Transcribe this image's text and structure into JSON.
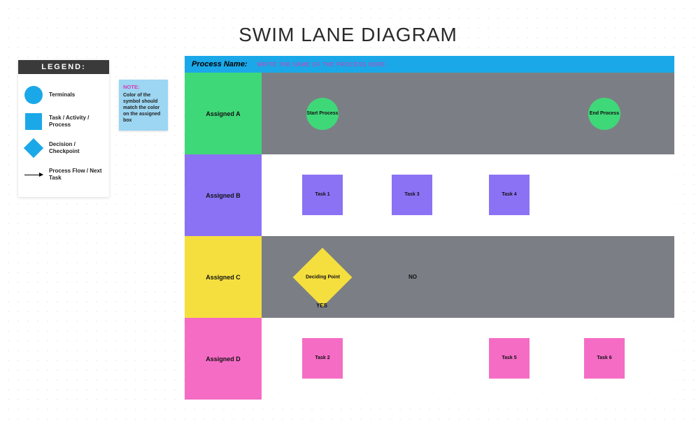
{
  "title": "SWIM LANE DIAGRAM",
  "legend": {
    "header": "LEGEND:",
    "items": [
      {
        "label": "Terminals"
      },
      {
        "label": "Task / Activity / Process"
      },
      {
        "label": "Decision / Checkpoint"
      },
      {
        "label": "Process Flow / Next Task"
      }
    ]
  },
  "note": {
    "header": "NOTE:",
    "text": "Color of the symbol should match the color on the assigned box"
  },
  "process": {
    "label": "Process Name:",
    "placeholder": "WRITE THE NAME OF THE PROCESS HERE."
  },
  "lanes": {
    "a": "Assigned A",
    "b": "Assigned B",
    "c": "Assigned C",
    "d": "Assigned D"
  },
  "nodes": {
    "start": "Start Process",
    "end": "End Process",
    "task1": "Task 1",
    "task2": "Task 2",
    "task3": "Task 3",
    "task4": "Task 4",
    "task5": "Task 5",
    "task6": "Task 6",
    "decision": "Deciding Point",
    "yes": "YES",
    "no": "NO"
  },
  "colors": {
    "terminal": "#3fd878",
    "taskB": "#8b72f5",
    "taskC": "#f5df3f",
    "taskD": "#f56cc5",
    "legendBlue": "#1ba8e8",
    "laneGrey": "#7b7f85"
  },
  "chart_data": {
    "type": "swimlane-flowchart",
    "title": "SWIM LANE DIAGRAM",
    "lanes": [
      {
        "id": "A",
        "name": "Assigned A",
        "color": "#3fd878"
      },
      {
        "id": "B",
        "name": "Assigned B",
        "color": "#8b72f5"
      },
      {
        "id": "C",
        "name": "Assigned C",
        "color": "#f5df3f"
      },
      {
        "id": "D",
        "name": "Assigned D",
        "color": "#f56cc5"
      }
    ],
    "nodes": [
      {
        "id": "start",
        "type": "terminal",
        "lane": "A",
        "label": "Start Process"
      },
      {
        "id": "t1",
        "type": "task",
        "lane": "B",
        "label": "Task 1"
      },
      {
        "id": "t3",
        "type": "task",
        "lane": "B",
        "label": "Task 3"
      },
      {
        "id": "t4",
        "type": "task",
        "lane": "B",
        "label": "Task 4"
      },
      {
        "id": "dec",
        "type": "decision",
        "lane": "C",
        "label": "Deciding Point"
      },
      {
        "id": "t2",
        "type": "task",
        "lane": "D",
        "label": "Task 2"
      },
      {
        "id": "t5",
        "type": "task",
        "lane": "D",
        "label": "Task 5"
      },
      {
        "id": "t6",
        "type": "task",
        "lane": "D",
        "label": "Task 6"
      },
      {
        "id": "end",
        "type": "terminal",
        "lane": "A",
        "label": "End Process"
      }
    ],
    "edges": [
      {
        "from": "start",
        "to": "t1"
      },
      {
        "from": "t1",
        "to": "dec"
      },
      {
        "from": "dec",
        "to": "t2",
        "label": "YES"
      },
      {
        "from": "dec",
        "to": "t3",
        "label": "NO"
      },
      {
        "from": "t3",
        "to": "t4"
      },
      {
        "from": "t4",
        "to": "t5"
      },
      {
        "from": "t2",
        "to": "t5"
      },
      {
        "from": "t5",
        "to": "t6"
      },
      {
        "from": "t6",
        "to": "end"
      }
    ]
  }
}
